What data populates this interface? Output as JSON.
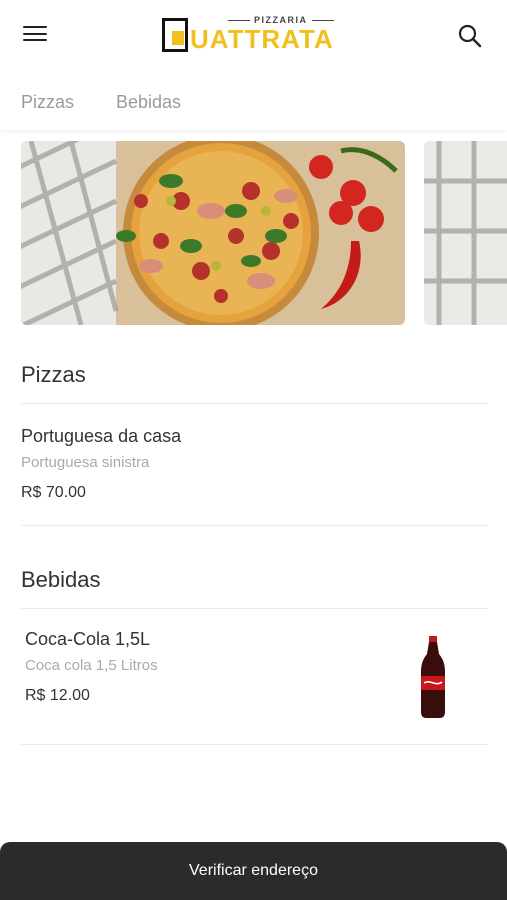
{
  "brand": {
    "sub": "PIZZARIA",
    "name": "UATTRATA",
    "accent": "#f0c020"
  },
  "tabs": [
    {
      "label": "Pizzas"
    },
    {
      "label": "Bebidas"
    }
  ],
  "sections": [
    {
      "title": "Pizzas",
      "items": [
        {
          "name": "Portuguesa da casa",
          "description": "Portuguesa sinistra",
          "price": "R$ 70.00"
        }
      ]
    },
    {
      "title": "Bebidas",
      "items": [
        {
          "name": "Coca-Cola 1,5L",
          "description": "Coca cola 1,5 Litros",
          "price": "R$ 12.00",
          "image": "coca-cola-bottle"
        }
      ]
    }
  ],
  "cta": {
    "label": "Verificar endereço"
  },
  "icons": {
    "menu": "hamburger-menu-icon",
    "search": "search-icon"
  }
}
